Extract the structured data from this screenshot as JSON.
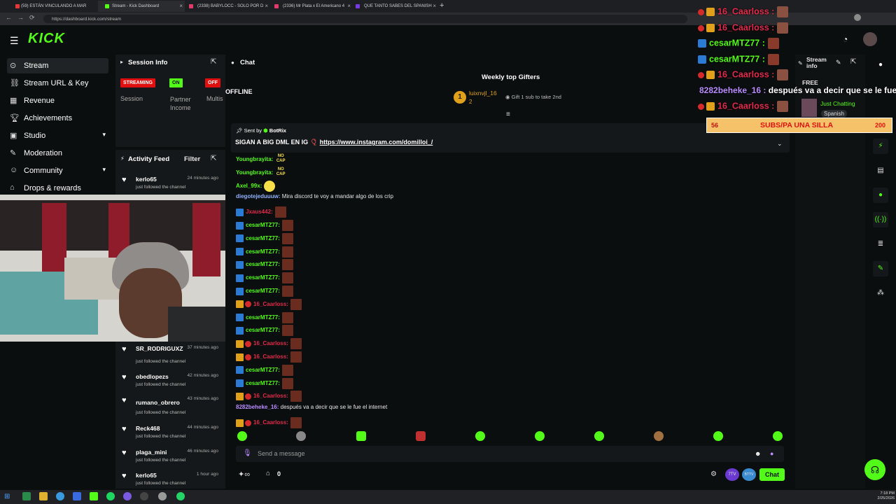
{
  "browser": {
    "tabs": [
      {
        "label": "(59) ESTÁN VINCULANDO A MAR",
        "color": "#e23a3a"
      },
      {
        "label": "Stream - Kick Dashboard",
        "color": "#53fc18"
      },
      {
        "label": "(2338) BABYLOCC - SOLO POR D",
        "color": "#e23a6a"
      },
      {
        "label": "(2336) Mr Plata x El Americano 4",
        "color": "#e23a6a"
      },
      {
        "label": "QUE TANTO SABES DEL SPANISH",
        "color": "#7a3ae2"
      }
    ],
    "url": "https://dashboard.kick.com/stream"
  },
  "logo": "KICK",
  "sidebar": {
    "items": [
      {
        "label": "Stream",
        "icon": "broadcast-icon",
        "active": true
      },
      {
        "label": "Stream URL & Key",
        "icon": "link-icon"
      },
      {
        "label": "Revenue",
        "icon": "revenue-icon"
      },
      {
        "label": "Achievements",
        "icon": "trophy-icon"
      },
      {
        "label": "Studio",
        "icon": "studio-icon",
        "chevron": true
      },
      {
        "label": "Moderation",
        "icon": "wrench-icon"
      },
      {
        "label": "Community",
        "icon": "community-icon",
        "chevron": true
      },
      {
        "label": "Drops & rewards",
        "icon": "gift-icon"
      }
    ]
  },
  "session": {
    "title": "Session Info",
    "streaming": "STREAMING",
    "on": "ON",
    "off": "OFF",
    "session_label": "Session",
    "partner_label": "Partner Income",
    "multi_label": "Multis"
  },
  "activity": {
    "title": "Activity Feed",
    "filter": "Filter",
    "items": [
      {
        "name": "kerlo65",
        "time": "24 minutes ago",
        "desc": "just followed the channel"
      },
      {
        "name": "SR_RODRIGUXZ",
        "time": "37 minutes ago",
        "desc": "just followed the channel"
      },
      {
        "name": "obedlopezs",
        "time": "42 minutes ago",
        "desc": "just followed the channel"
      },
      {
        "name": "rumano_obrero",
        "time": "43 minutes ago",
        "desc": "just followed the channel"
      },
      {
        "name": "Reck468",
        "time": "44 minutes ago",
        "desc": "just followed the channel"
      },
      {
        "name": "plaga_mini",
        "time": "46 minutes ago",
        "desc": "just followed the channel"
      },
      {
        "name": "kerlo65",
        "time": "1 hour ago",
        "desc": "just followed the channel"
      }
    ]
  },
  "chat": {
    "title": "Chat",
    "gifters_title": "Weekly top Gifters",
    "offline": "OFFLINE",
    "top_gifter": "luixnvjl_16",
    "top_gifter_count": "2",
    "gift_hint": "Gift 1 sub to take 2nd",
    "pinned_sent_by": "Sent by",
    "pinned_user": "BotRix",
    "pinned_text": "SIGAN A BIG DML EN IG",
    "pinned_link": "https://www.instagram.com/domilloi_/",
    "messages": [
      {
        "user": "Youngbrayita:",
        "color": "#53fc18",
        "emote_text": "NO CAP"
      },
      {
        "user": "Youngbrayita:",
        "color": "#53fc18",
        "emote_text": "NO CAP"
      },
      {
        "user": "Axel_99x:",
        "color": "#53fc18",
        "emote_text": ""
      },
      {
        "user": "diegotejeduuuw:",
        "color": "#8fb3ff",
        "text": "Mira discord te voy a mandar algo de los crip"
      },
      {
        "user": "Jxaus442:",
        "color": "#e02a4a",
        "kick": true
      },
      {
        "user": "cesarMTZ77:",
        "color": "#53fc18",
        "kick": true
      },
      {
        "user": "cesarMTZ77:",
        "color": "#53fc18",
        "kick": true
      },
      {
        "user": "cesarMTZ77:",
        "color": "#53fc18",
        "kick": true
      },
      {
        "user": "cesarMTZ77:",
        "color": "#53fc18",
        "kick": true
      },
      {
        "user": "cesarMTZ77:",
        "color": "#53fc18",
        "kick": true
      },
      {
        "user": "cesarMTZ77:",
        "color": "#53fc18",
        "kick": true
      },
      {
        "user": "16_Caarloss:",
        "color": "#e02a4a",
        "crown": true
      },
      {
        "user": "cesarMTZ77:",
        "color": "#53fc18",
        "kick": true
      },
      {
        "user": "cesarMTZ77:",
        "color": "#53fc18",
        "kick": true
      },
      {
        "user": "16_Caarloss:",
        "color": "#e02a4a",
        "crown": true
      },
      {
        "user": "16_Caarloss:",
        "color": "#e02a4a",
        "crown": true
      },
      {
        "user": "cesarMTZ77:",
        "color": "#53fc18",
        "kick": true
      },
      {
        "user": "cesarMTZ77:",
        "color": "#53fc18",
        "kick": true
      },
      {
        "user": "16_Caarloss:",
        "color": "#e02a4a",
        "crown": true
      },
      {
        "user": "8282beheke_16:",
        "color": "#b98cff",
        "text": "después va a decir que se le fue el internet"
      },
      {
        "user": "16_Caarloss:",
        "color": "#e02a4a",
        "crown": true
      }
    ],
    "input_placeholder": "Send a message",
    "viewer_count": "0",
    "send": "Chat",
    "seventv": "7TV",
    "bttv": "BTTV"
  },
  "stream_info": {
    "title": "Stream info",
    "free": "FREE",
    "category": "Just Chatting",
    "language": "Spanish"
  },
  "overlay": {
    "lines": [
      {
        "user": "16_Caarloss :",
        "color": "#e02a4a",
        "crown": true
      },
      {
        "user": "16_Caarloss :",
        "color": "#e02a4a",
        "crown": true
      },
      {
        "user": "cesarMTZ77 :",
        "color": "#53fc18",
        "kick": true
      },
      {
        "user": "cesarMTZ77 :",
        "color": "#53fc18",
        "kick": true
      },
      {
        "user": "16_Caarloss :",
        "color": "#e02a4a",
        "crown": true
      },
      {
        "user": "8282beheke_16 :",
        "color": "#b98cff",
        "text": "después va a decir que se le fue el"
      },
      {
        "user": "16_Caarloss :",
        "color": "#e02a4a",
        "crown": true
      }
    ],
    "goal_left": "56",
    "goal_text": "SUBS/PA UNA SILLA",
    "goal_right": "200"
  },
  "clock": {
    "time": "7:18 PM",
    "date": "2/25/2026"
  },
  "colors": {
    "kick_green": "#53fc18",
    "streaming_red": "#e01010",
    "on_green": "#53fc18"
  }
}
